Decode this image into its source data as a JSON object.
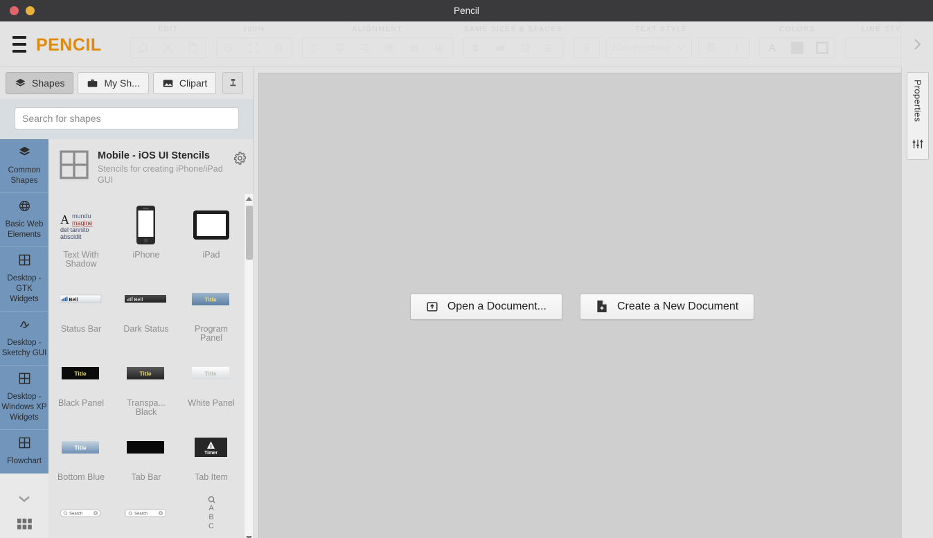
{
  "window": {
    "title": "Pencil",
    "controls": [
      {
        "name": "close",
        "color": "#e0646a"
      },
      {
        "name": "minimize",
        "color": "#e8b23a"
      }
    ]
  },
  "toolbar": {
    "brand": "PENCIL",
    "menu_icon": "hamburger-icon",
    "expand_icon": "chevron-right-icon",
    "groups": [
      {
        "label": "EDIT",
        "items": [
          {
            "name": "copy-button",
            "icon": "copy-icon"
          },
          {
            "name": "cut-button",
            "icon": "scissors-icon"
          },
          {
            "name": "paste-button",
            "icon": "clipboard-icon"
          }
        ]
      },
      {
        "label": "100%",
        "items": [
          {
            "name": "zoom-out-button",
            "icon": "zoom-out-icon"
          },
          {
            "name": "zoom-fit-button",
            "icon": "fit-screen-icon"
          },
          {
            "name": "zoom-in-button",
            "icon": "zoom-in-icon"
          }
        ]
      },
      {
        "label": "ALIGNMENT",
        "items": [
          {
            "name": "align-left-button",
            "icon": "align-left-icon"
          },
          {
            "name": "align-center-button",
            "icon": "align-center-icon"
          },
          {
            "name": "align-right-button",
            "icon": "align-right-icon"
          },
          {
            "name": "align-top-button",
            "icon": "align-top-icon"
          },
          {
            "name": "align-middle-button",
            "icon": "align-middle-icon"
          },
          {
            "name": "align-bottom-button",
            "icon": "align-bottom-icon"
          }
        ]
      },
      {
        "label": "SAME SIZES & SPACES",
        "items": [
          {
            "name": "same-height-button",
            "icon": "same-height-icon"
          },
          {
            "name": "same-width-button",
            "icon": "same-width-icon"
          },
          {
            "name": "distribute-horizontal-button",
            "icon": "distribute-h-icon"
          },
          {
            "name": "distribute-vertical-button",
            "icon": "distribute-v-icon"
          }
        ]
      },
      {
        "label": "TEXT STYLE",
        "font_value": "Handwriting",
        "items": [
          {
            "name": "text-format-button",
            "icon": "paint-format-icon"
          },
          {
            "name": "bold-button",
            "label": "B"
          },
          {
            "name": "italic-button",
            "label": "I"
          }
        ]
      },
      {
        "label": "COLORS",
        "items": [
          {
            "name": "text-color-button",
            "label": "A"
          },
          {
            "name": "fill-color-button",
            "icon": "filled-square-icon"
          },
          {
            "name": "stroke-color-button",
            "icon": "outlined-square-icon"
          }
        ]
      },
      {
        "label": "LINE STYLE",
        "items": [
          {
            "name": "line-style-select",
            "icon": "line-preview-icon"
          }
        ]
      }
    ]
  },
  "collection_panel": {
    "tabs": [
      {
        "label": "Shapes",
        "icon": "layers-icon",
        "active": true
      },
      {
        "label": "My Sh...",
        "icon": "briefcase-icon",
        "active": false
      },
      {
        "label": "Clipart",
        "icon": "image-icon",
        "active": false
      }
    ],
    "pin_icon": "pin-icon",
    "search": {
      "placeholder": "Search for shapes",
      "value": ""
    },
    "categories": [
      {
        "label": "Common Shapes",
        "icon": "layers-icon"
      },
      {
        "label": "Basic Web Elements",
        "icon": "globe-icon"
      },
      {
        "label": "Desktop - GTK Widgets",
        "icon": "grid-icon"
      },
      {
        "label": "Desktop - Sketchy GUI",
        "icon": "scribble-icon"
      },
      {
        "label": "Desktop - Windows XP Widgets",
        "icon": "grid-icon"
      },
      {
        "label": "Flowchart",
        "icon": "grid-icon"
      }
    ],
    "more_chevron_icon": "chevron-down-icon",
    "all_collections_icon": "grid-apps-icon",
    "collection": {
      "icon": "grid-icon",
      "title": "Mobile - iOS UI Stencils",
      "description": "Stencils for creating iPhone/iPad GUI",
      "settings_icon": "gear-icon"
    },
    "shapes": [
      {
        "label": "Text With Shadow",
        "thumb": "text-with-shadow"
      },
      {
        "label": "iPhone",
        "thumb": "iphone"
      },
      {
        "label": "iPad",
        "thumb": "ipad"
      },
      {
        "label": "Status Bar",
        "thumb": "status-bar"
      },
      {
        "label": "Dark Status",
        "thumb": "dark-status"
      },
      {
        "label": "Program Panel",
        "thumb": "program-panel"
      },
      {
        "label": "Black Panel",
        "thumb": "black-panel"
      },
      {
        "label": "Transpa... Black",
        "thumb": "transparent-black"
      },
      {
        "label": "White Panel",
        "thumb": "white-panel"
      },
      {
        "label": "Bottom Blue",
        "thumb": "bottom-blue"
      },
      {
        "label": "Tab Bar",
        "thumb": "tab-bar"
      },
      {
        "label": "Tab Item",
        "thumb": "tab-item"
      },
      {
        "label": "",
        "thumb": "search-field-rounded"
      },
      {
        "label": "",
        "thumb": "search-field-square"
      },
      {
        "label": "",
        "thumb": "index-list"
      }
    ],
    "thumb_text": {
      "title": "Title",
      "bell": "Bell",
      "timer": "Timer",
      "search": "Search",
      "shadow_a": "A",
      "shadow_lines": [
        "mundu",
        "magine",
        "del tannito",
        "abscidit"
      ],
      "index_letters": [
        "A",
        "B",
        "C"
      ]
    }
  },
  "canvas": {
    "start_buttons": [
      {
        "label": "Open a Document...",
        "icon": "open-document-icon"
      },
      {
        "label": "Create a New Document",
        "icon": "new-document-icon"
      }
    ]
  },
  "properties_panel": {
    "label": "Properties",
    "icon": "sliders-icon"
  },
  "colors": {
    "brand_orange": "#e08a0b",
    "titlebar": "#3a3a3c",
    "chrome": "#e3e3e3",
    "category_blue": "#7295bb",
    "canvas": "#cfcfcf",
    "search_band": "#d7dde0"
  }
}
